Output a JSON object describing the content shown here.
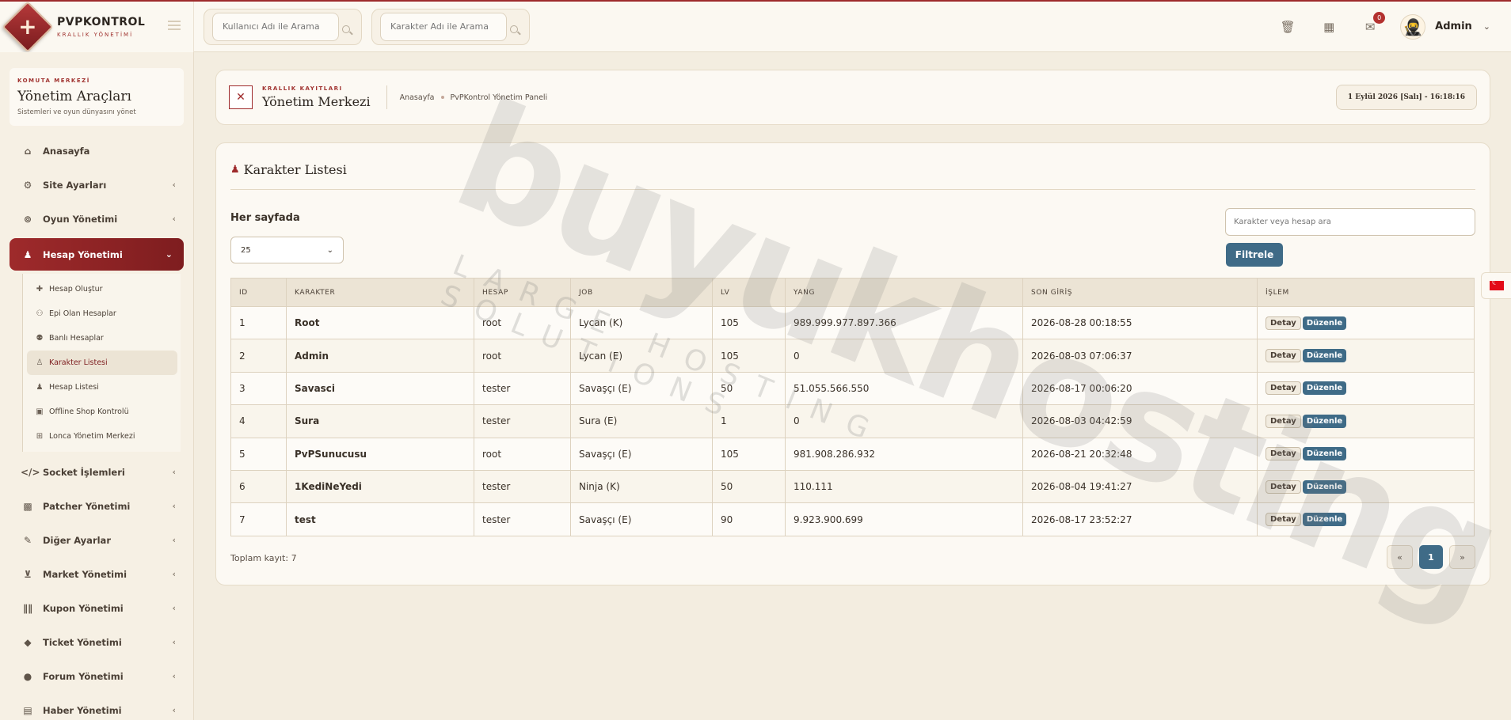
{
  "brand": {
    "title": "PVPKONTROL",
    "subtitle": "KRALLIK YÖNETİMİ"
  },
  "top_search": {
    "user_placeholder": "Kullanıcı Adı ile Arama",
    "char_placeholder": "Karakter Adı ile Arama"
  },
  "top_icons": [
    "trash-icon",
    "calendar-icon",
    "mail-icon"
  ],
  "notifications": {
    "count": "0"
  },
  "user": {
    "name": "Admin"
  },
  "sidebar": {
    "kicker": "KOMUTA MERKEZİ",
    "title": "Yönetim Araçları",
    "desc": "Sistemleri ve oyun dünyasını yönet",
    "items": [
      {
        "label": "Anasayfa",
        "icon": "home-icon"
      },
      {
        "label": "Site Ayarları",
        "icon": "gear-icon"
      },
      {
        "label": "Oyun Yönetimi",
        "icon": "gamepad-icon"
      },
      {
        "label": "Hesap Yönetimi",
        "icon": "users-icon"
      },
      {
        "label": "Socket İşlemleri",
        "icon": "code-icon"
      },
      {
        "label": "Patcher Yönetimi",
        "icon": "box-icon"
      },
      {
        "label": "Diğer Ayarlar",
        "icon": "wrench-icon"
      },
      {
        "label": "Market Yönetimi",
        "icon": "cart-icon"
      },
      {
        "label": "Kupon Yönetimi",
        "icon": "barcode-icon"
      },
      {
        "label": "Ticket Yönetimi",
        "icon": "ticket-icon"
      },
      {
        "label": "Forum Yönetimi",
        "icon": "comments-icon"
      },
      {
        "label": "Haber Yönetimi",
        "icon": "newspaper-icon"
      }
    ],
    "sub_items": [
      {
        "label": "Hesap Oluştur",
        "icon": "plus-icon"
      },
      {
        "label": "Epi Olan Hesaplar",
        "icon": "users-cog-icon"
      },
      {
        "label": "Banlı Hesaplar",
        "icon": "user-lock-icon"
      },
      {
        "label": "Karakter Listesi",
        "icon": "person-icon"
      },
      {
        "label": "Hesap Listesi",
        "icon": "users-icon"
      },
      {
        "label": "Offline Shop Kontrolü",
        "icon": "briefcase-icon"
      },
      {
        "label": "Lonca Yönetim Merkezi",
        "icon": "sitemap-icon"
      }
    ]
  },
  "header": {
    "kicker": "KRALLIK KAYITLARI",
    "title": "Yönetim Merkezi",
    "breadcrumb": [
      "Anasayfa",
      "PvPKontrol Yönetim Paneli"
    ],
    "datetime": "1 Eylül 2026 [Salı] - 16:18:16"
  },
  "list": {
    "title": "Karakter Listesi",
    "per_page_label": "Her sayfada",
    "per_page_value": "25",
    "search_placeholder": "Karakter veya hesap ara",
    "filter_label": "Filtrele",
    "columns": [
      "ID",
      "KARAKTER",
      "HESAP",
      "JOB",
      "LV",
      "YANG",
      "SON GİRİŞ",
      "İŞLEM"
    ],
    "rows": [
      [
        "1",
        "Root",
        "root",
        "Lycan (K)",
        "105",
        "989.999.977.897.366",
        "2026-08-28 00:18:55"
      ],
      [
        "2",
        "Admin",
        "root",
        "Lycan (E)",
        "105",
        "0",
        "2026-08-03 07:06:37"
      ],
      [
        "3",
        "Savasci",
        "tester",
        "Savaşçı (E)",
        "50",
        "51.055.566.550",
        "2026-08-17 00:06:20"
      ],
      [
        "4",
        "Sura",
        "tester",
        "Sura (E)",
        "1",
        "0",
        "2026-08-03 04:42:59"
      ],
      [
        "5",
        "PvPSunucusu",
        "root",
        "Savaşçı (E)",
        "105",
        "981.908.286.932",
        "2026-08-21 20:32:48"
      ],
      [
        "6",
        "1KediNeYedi",
        "tester",
        "Ninja (K)",
        "50",
        "110.111",
        "2026-08-04 19:41:27"
      ],
      [
        "7",
        "test",
        "tester",
        "Savaşçı (E)",
        "90",
        "9.923.900.699",
        "2026-08-17 23:52:27"
      ]
    ],
    "detail_label": "Detay",
    "edit_label": "Düzenle",
    "total": "Toplam kayıt: 7",
    "pager": {
      "prev": "«",
      "current": "1",
      "next": "»"
    }
  },
  "watermark": {
    "main": "buyukhosting",
    "sub": "LARGE HOSTING SOLUTIONS"
  },
  "colors": {
    "accent": "#9e2a2b",
    "primary": "#3f6b87",
    "background": "#f3ede0"
  }
}
